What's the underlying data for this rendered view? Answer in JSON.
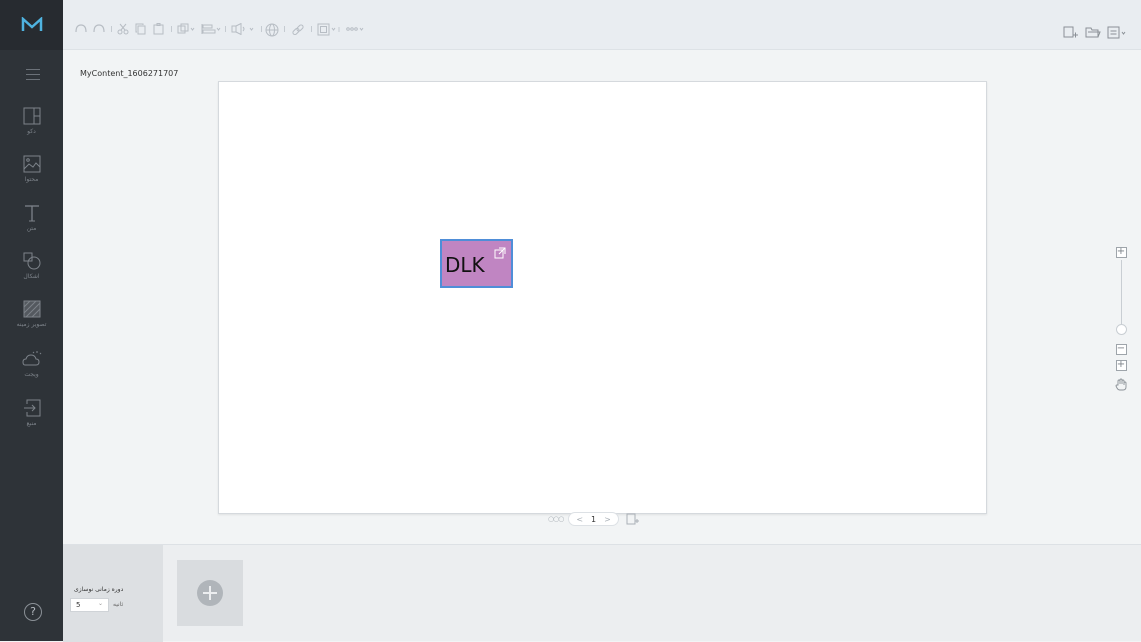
{
  "app": {
    "logo_icon": "m-logo-icon",
    "brand_color": "#4fb3e0"
  },
  "sidebar": {
    "items": [
      {
        "label": "دکو",
        "icon": "layout-icon"
      },
      {
        "label": "محتوا",
        "icon": "image-icon"
      },
      {
        "label": "متن",
        "icon": "text-icon"
      },
      {
        "label": "اشکال",
        "icon": "shapes-icon"
      },
      {
        "label": "تصویر زمینه",
        "icon": "background-pattern-icon"
      },
      {
        "label": "ویجت",
        "icon": "weather-widget-icon"
      },
      {
        "label": "منبع",
        "icon": "source-import-icon"
      }
    ],
    "help_label": "?"
  },
  "toolbar": {
    "left_icons": [
      "undo-icon",
      "redo-icon",
      "cut-icon",
      "copy-icon",
      "paste-icon",
      "arrange-icon",
      "align-icon",
      "audio-icon",
      "web-icon",
      "link-icon",
      "frame-icon",
      "more-icon"
    ],
    "right_icons": [
      "new-content-icon",
      "open-folder-icon",
      "save-icon"
    ]
  },
  "workspace": {
    "content_name": "MyContent_1606271707",
    "element": {
      "text": "DLK",
      "fill_color": "#c085c2",
      "border_color": "#4f8ed8"
    },
    "pager": {
      "current_page": "1",
      "prev": "<",
      "next": ">"
    },
    "zoom": {
      "zoom_in": "+",
      "zoom_out": "−",
      "fit": "+",
      "level": 0.08
    }
  },
  "bottom": {
    "duration_label": "دوره زمانی نوسازی",
    "duration_value": "5",
    "duration_unit": "ثانیه"
  }
}
